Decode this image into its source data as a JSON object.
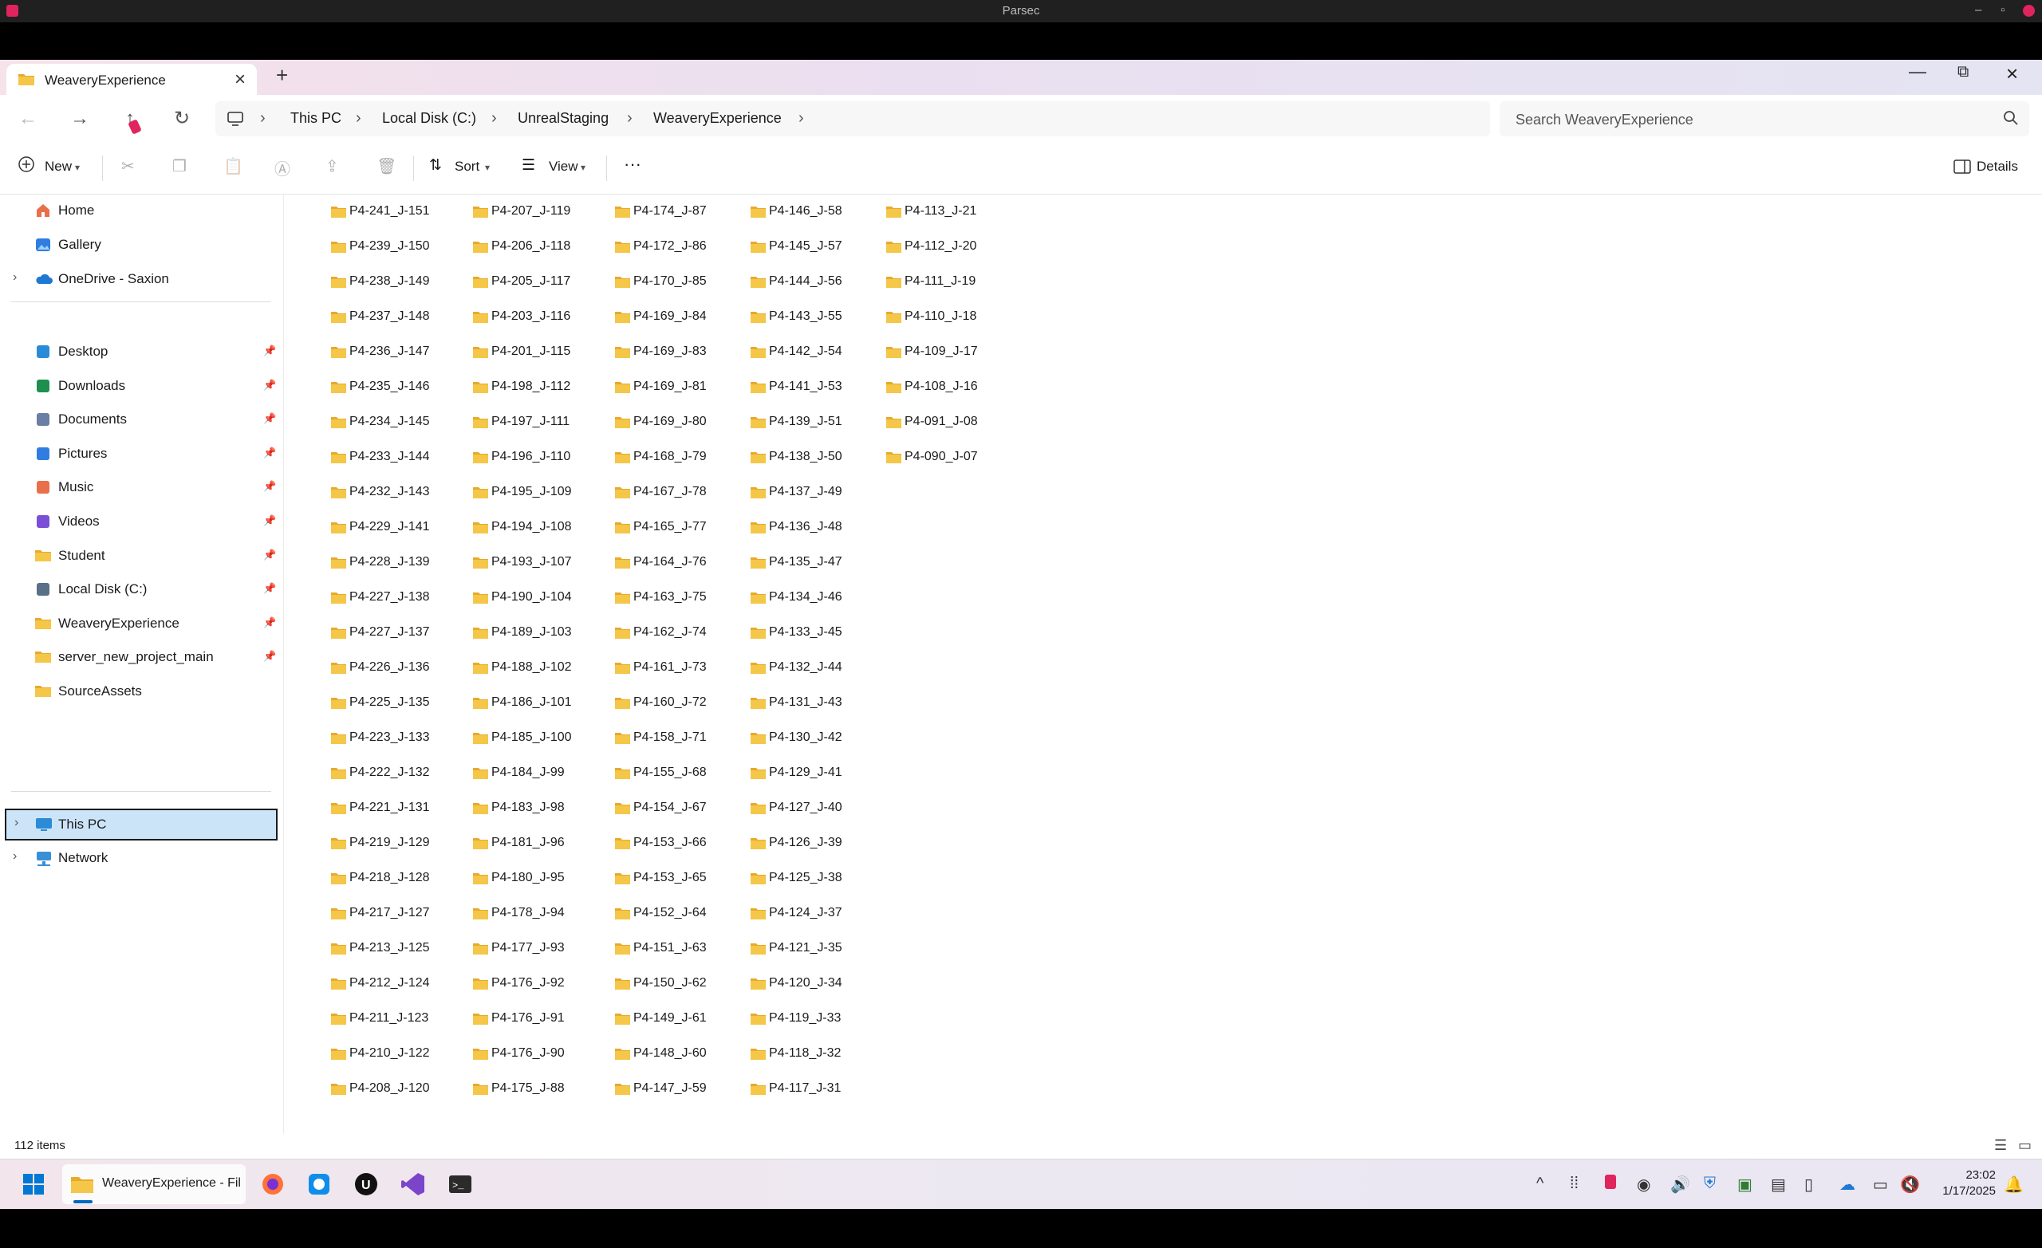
{
  "parsec": {
    "title": "Parsec"
  },
  "window": {
    "tab_title": "WeaveryExperience",
    "new_tab": "+"
  },
  "breadcrumb": [
    "This PC",
    "Local Disk (C:)",
    "UnrealStaging",
    "WeaveryExperience"
  ],
  "search": {
    "placeholder": "Search WeaveryExperience"
  },
  "toolbar": {
    "new_label": "New",
    "sort_label": "Sort",
    "view_label": "View",
    "details_label": "Details"
  },
  "sidebar": {
    "top": [
      "Home",
      "Gallery",
      "OneDrive - Saxion"
    ],
    "quick_access": [
      {
        "label": "Desktop",
        "icon": "desktop-icon",
        "pinned": true
      },
      {
        "label": "Downloads",
        "icon": "download-icon",
        "pinned": true
      },
      {
        "label": "Documents",
        "icon": "documents-icon",
        "pinned": true
      },
      {
        "label": "Pictures",
        "icon": "pictures-icon",
        "pinned": true
      },
      {
        "label": "Music",
        "icon": "music-icon",
        "pinned": true
      },
      {
        "label": "Videos",
        "icon": "videos-icon",
        "pinned": true
      },
      {
        "label": "Student",
        "icon": "folder-icon",
        "pinned": true
      },
      {
        "label": "Local Disk (C:)",
        "icon": "drive-icon",
        "pinned": true
      },
      {
        "label": "WeaveryExperience",
        "icon": "folder-icon",
        "pinned": true
      },
      {
        "label": "server_new_project_main",
        "icon": "folder-icon",
        "pinned": true
      },
      {
        "label": "SourceAssets",
        "icon": "folder-icon",
        "pinned": false
      }
    ],
    "bottom": [
      "This PC",
      "Network"
    ]
  },
  "folders": [
    [
      "P4-241_J-151",
      "P4-239_J-150",
      "P4-238_J-149",
      "P4-237_J-148",
      "P4-236_J-147",
      "P4-235_J-146",
      "P4-234_J-145",
      "P4-233_J-144",
      "P4-232_J-143",
      "P4-229_J-141",
      "P4-228_J-139",
      "P4-227_J-138",
      "P4-227_J-137",
      "P4-226_J-136",
      "P4-225_J-135",
      "P4-223_J-133",
      "P4-222_J-132",
      "P4-221_J-131",
      "P4-219_J-129",
      "P4-218_J-128",
      "P4-217_J-127",
      "P4-213_J-125",
      "P4-212_J-124",
      "P4-211_J-123",
      "P4-210_J-122",
      "P4-208_J-120"
    ],
    [
      "P4-207_J-119",
      "P4-206_J-118",
      "P4-205_J-117",
      "P4-203_J-116",
      "P4-201_J-115",
      "P4-198_J-112",
      "P4-197_J-111",
      "P4-196_J-110",
      "P4-195_J-109",
      "P4-194_J-108",
      "P4-193_J-107",
      "P4-190_J-104",
      "P4-189_J-103",
      "P4-188_J-102",
      "P4-186_J-101",
      "P4-185_J-100",
      "P4-184_J-99",
      "P4-183_J-98",
      "P4-181_J-96",
      "P4-180_J-95",
      "P4-178_J-94",
      "P4-177_J-93",
      "P4-176_J-92",
      "P4-176_J-91",
      "P4-176_J-90",
      "P4-175_J-88"
    ],
    [
      "P4-174_J-87",
      "P4-172_J-86",
      "P4-170_J-85",
      "P4-169_J-84",
      "P4-169_J-83",
      "P4-169_J-81",
      "P4-169_J-80",
      "P4-168_J-79",
      "P4-167_J-78",
      "P4-165_J-77",
      "P4-164_J-76",
      "P4-163_J-75",
      "P4-162_J-74",
      "P4-161_J-73",
      "P4-160_J-72",
      "P4-158_J-71",
      "P4-155_J-68",
      "P4-154_J-67",
      "P4-153_J-66",
      "P4-153_J-65",
      "P4-152_J-64",
      "P4-151_J-63",
      "P4-150_J-62",
      "P4-149_J-61",
      "P4-148_J-60",
      "P4-147_J-59"
    ],
    [
      "P4-146_J-58",
      "P4-145_J-57",
      "P4-144_J-56",
      "P4-143_J-55",
      "P4-142_J-54",
      "P4-141_J-53",
      "P4-139_J-51",
      "P4-138_J-50",
      "P4-137_J-49",
      "P4-136_J-48",
      "P4-135_J-47",
      "P4-134_J-46",
      "P4-133_J-45",
      "P4-132_J-44",
      "P4-131_J-43",
      "P4-130_J-42",
      "P4-129_J-41",
      "P4-127_J-40",
      "P4-126_J-39",
      "P4-125_J-38",
      "P4-124_J-37",
      "P4-121_J-35",
      "P4-120_J-34",
      "P4-119_J-33",
      "P4-118_J-32",
      "P4-117_J-31"
    ],
    [
      "P4-113_J-21",
      "P4-112_J-20",
      "P4-111_J-19",
      "P4-110_J-18",
      "P4-109_J-17",
      "P4-108_J-16",
      "P4-091_J-08",
      "P4-090_J-07"
    ]
  ],
  "status": {
    "item_count": "112 items"
  },
  "taskbar": {
    "explorer_label": "WeaveryExperience - Fil",
    "time": "23:02",
    "date": "1/17/2025"
  },
  "colors": {
    "folder": "#f5c748",
    "accent": "#0067c0",
    "selection": "#cce4f7"
  }
}
